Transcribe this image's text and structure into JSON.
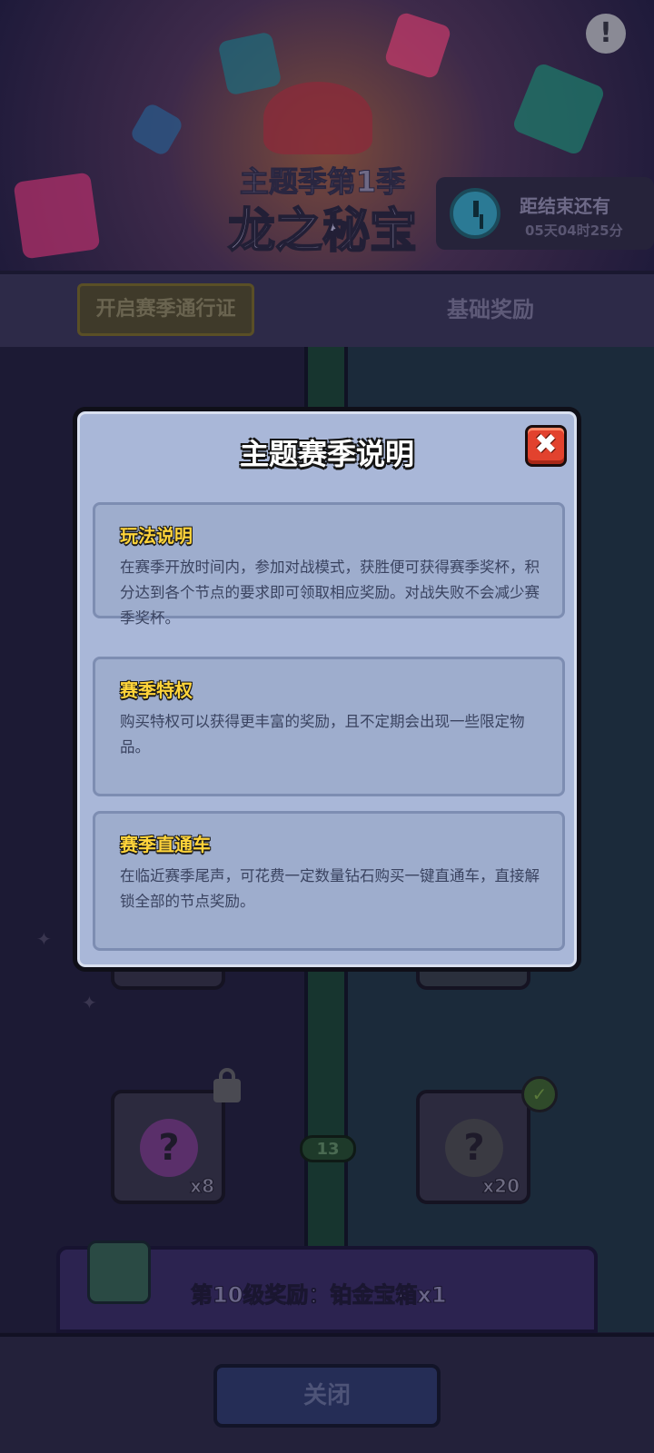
{
  "header": {
    "season_subtitle": "主题季第1季",
    "season_title": "龙之秘宝",
    "timer_label": "距结束还有",
    "timer_value": "05天04时25分",
    "info_icon": "!"
  },
  "tabs": {
    "pass_tab": "开启赛季通行证",
    "basic_tab": "基础奖励"
  },
  "track": {
    "left_reward_count": "x8",
    "right_reward_count": "x20",
    "level": "13",
    "mystery_glyph": "?"
  },
  "reward_bar": {
    "text": "第10级奖励：铂金宝箱x1"
  },
  "footer": {
    "close_label": "关闭"
  },
  "modal": {
    "title": "主题赛季说明",
    "close_glyph": "✖",
    "sections": [
      {
        "title": "玩法说明",
        "body": "在赛季开放时间内，参加对战模式，获胜便可获得赛季奖杯，积分达到各个节点的要求即可领取相应奖励。对战失败不会减少赛季奖杯。"
      },
      {
        "title": "赛季特权",
        "body": "购买特权可以获得更丰富的奖励，且不定期会出现一些限定物品。"
      },
      {
        "title": "赛季直通车",
        "body": "在临近赛季尾声，可花费一定数量钻石购买一键直通车，直接解锁全部的节点奖励。"
      }
    ]
  },
  "colors": {
    "modal_bg": "#a9b7d8",
    "section_title": "#ffd43a",
    "close_button": "#e2422e"
  }
}
